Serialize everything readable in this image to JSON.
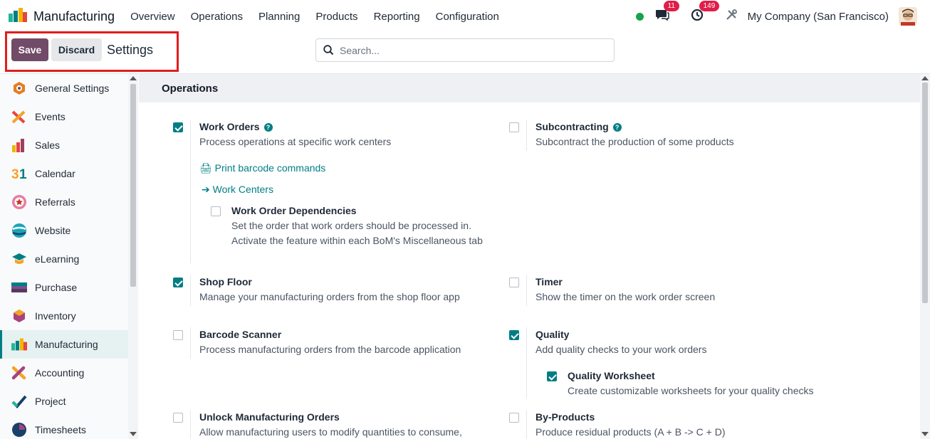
{
  "app": {
    "name": "Manufacturing"
  },
  "menu": [
    "Overview",
    "Operations",
    "Planning",
    "Products",
    "Reporting",
    "Configuration"
  ],
  "nav": {
    "messages_count": "11",
    "activities_count": "149",
    "company": "My Company (San Francisco)"
  },
  "control": {
    "save_label": "Save",
    "discard_label": "Discard",
    "title": "Settings",
    "search_placeholder": "Search..."
  },
  "sidebar": {
    "items": [
      {
        "label": "General Settings",
        "icon": "gear-hex-icon"
      },
      {
        "label": "Events",
        "icon": "events-icon"
      },
      {
        "label": "Sales",
        "icon": "sales-icon"
      },
      {
        "label": "Calendar",
        "icon": "calendar-icon"
      },
      {
        "label": "Referrals",
        "icon": "referrals-icon"
      },
      {
        "label": "Website",
        "icon": "website-icon"
      },
      {
        "label": "eLearning",
        "icon": "elearning-icon"
      },
      {
        "label": "Purchase",
        "icon": "purchase-icon"
      },
      {
        "label": "Inventory",
        "icon": "inventory-icon"
      },
      {
        "label": "Manufacturing",
        "icon": "manufacturing-icon"
      },
      {
        "label": "Accounting",
        "icon": "accounting-icon"
      },
      {
        "label": "Project",
        "icon": "project-icon"
      },
      {
        "label": "Timesheets",
        "icon": "timesheets-icon"
      }
    ],
    "active": "Manufacturing"
  },
  "section": {
    "title": "Operations"
  },
  "settings": {
    "work_orders": {
      "title": "Work Orders",
      "desc": "Process operations at specific work centers",
      "checked": true
    },
    "print_barcode": "Print barcode commands",
    "work_centers": "Work Centers",
    "wo_dependencies": {
      "title": "Work Order Dependencies",
      "desc": "Set the order that work orders should be processed in. Activate the feature within each BoM's Miscellaneous tab",
      "checked": false
    },
    "subcontracting": {
      "title": "Subcontracting",
      "desc": "Subcontract the production of some products",
      "checked": false
    },
    "shop_floor": {
      "title": "Shop Floor",
      "desc": "Manage your manufacturing orders from the shop floor app",
      "checked": true
    },
    "timer": {
      "title": "Timer",
      "desc": "Show the timer on the work order screen",
      "checked": false
    },
    "barcode_scanner": {
      "title": "Barcode Scanner",
      "desc": "Process manufacturing orders from the barcode application",
      "checked": false
    },
    "quality": {
      "title": "Quality",
      "desc": "Add quality checks to your work orders",
      "checked": true
    },
    "quality_worksheet": {
      "title": "Quality Worksheet",
      "desc": "Create customizable worksheets for your quality checks",
      "checked": true
    },
    "unlock_mo": {
      "title": "Unlock Manufacturing Orders",
      "desc": "Allow manufacturing users to modify quantities to consume,",
      "checked": false
    },
    "by_products": {
      "title": "By-Products",
      "desc": "Produce residual products (A + B -> C + D)",
      "checked": false
    }
  },
  "colors": {
    "primary": "#714b67",
    "accent": "#017e84",
    "highlight": "#e11d1d"
  }
}
